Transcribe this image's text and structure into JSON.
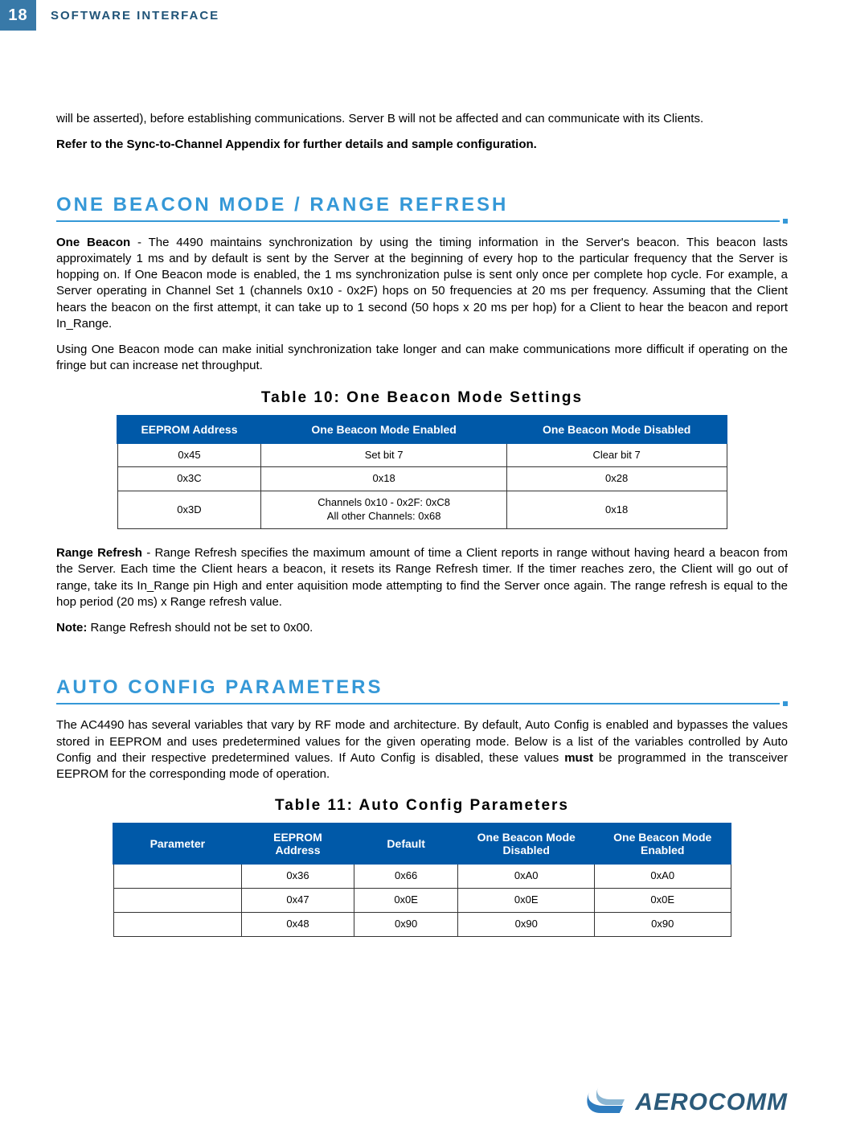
{
  "header": {
    "page_number": "18",
    "title": "SOFTWARE INTERFACE"
  },
  "intro": {
    "p1": "will be asserted), before establishing communications.  Server B will not be affected and can communicate with its Clients.",
    "p2": "Refer to the Sync-to-Channel Appendix for further details and sample configuration."
  },
  "section1": {
    "heading": "ONE BEACON MODE / RANGE REFRESH",
    "p1_bold": "One Beacon",
    "p1_rest": " - The 4490 maintains synchronization by using the timing information in the Server's beacon.  This beacon lasts approximately 1 ms and by default is sent by the Server at the beginning of every hop to the particular frequency that the Server is hopping on.  If One Beacon mode is enabled, the 1 ms synchronization pulse is sent only once per complete hop cycle.  For example, a Server operating in Channel Set 1 (channels 0x10 - 0x2F) hops on 50 frequencies at 20 ms per frequency.  Assuming that the Client hears the beacon on the first attempt, it can take up to 1 second (50 hops x 20 ms per hop) for a Client to hear the beacon and report In_Range.",
    "p2": "Using One Beacon mode can make initial synchronization take longer and can make communications more difficult if operating on the fringe but can increase net throughput.",
    "table_title": "Table 10: One Beacon Mode Settings",
    "table": {
      "headers": [
        "EEPROM Address",
        "One Beacon Mode Enabled",
        "One Beacon Mode Disabled"
      ],
      "rows": [
        [
          "0x45",
          "Set bit 7",
          "Clear bit 7"
        ],
        [
          "0x3C",
          "0x18",
          "0x28"
        ],
        [
          "0x3D",
          "Channels 0x10 - 0x2F: 0xC8\nAll other Channels: 0x68",
          "0x18"
        ]
      ]
    },
    "p3_bold": "Range Refresh",
    "p3_rest": " - Range Refresh specifies the maximum amount of time a Client reports in range without having heard a beacon from the Server.  Each time the Client hears a beacon, it resets its Range Refresh timer.  If the timer reaches zero, the Client will go out of range, take its In_Range pin High and enter aquisition mode attempting to find the Server once again.  The range refresh is equal to the hop period (20 ms) x Range refresh value.",
    "p4_bold": "Note:",
    "p4_rest": " Range Refresh should not be set to 0x00."
  },
  "section2": {
    "heading": "AUTO CONFIG PARAMETERS",
    "p1_a": "The AC4490 has several variables that vary by RF mode and architecture.  By default, Auto Config is enabled and bypasses the values stored in EEPROM and uses predetermined values for the given operating mode.  Below is a list of the variables controlled by Auto Config and their respective predetermined values.  If Auto Config is disabled, these values ",
    "p1_bold": "must",
    "p1_b": " be programmed in the transceiver EEPROM for the corresponding mode of operation.",
    "table_title": "Table 11: Auto Config Parameters",
    "table": {
      "headers": [
        "Parameter",
        "EEPROM Address",
        "Default",
        "One Beacon Mode Disabled",
        "One Beacon Mode Enabled"
      ],
      "rows": [
        [
          "",
          "0x36",
          "0x66",
          "0xA0",
          "0xA0"
        ],
        [
          "",
          "0x47",
          "0x0E",
          "0x0E",
          "0x0E"
        ],
        [
          "",
          "0x48",
          "0x90",
          "0x90",
          "0x90"
        ]
      ]
    }
  },
  "footer": {
    "logo_text": "AEROCOMM"
  }
}
